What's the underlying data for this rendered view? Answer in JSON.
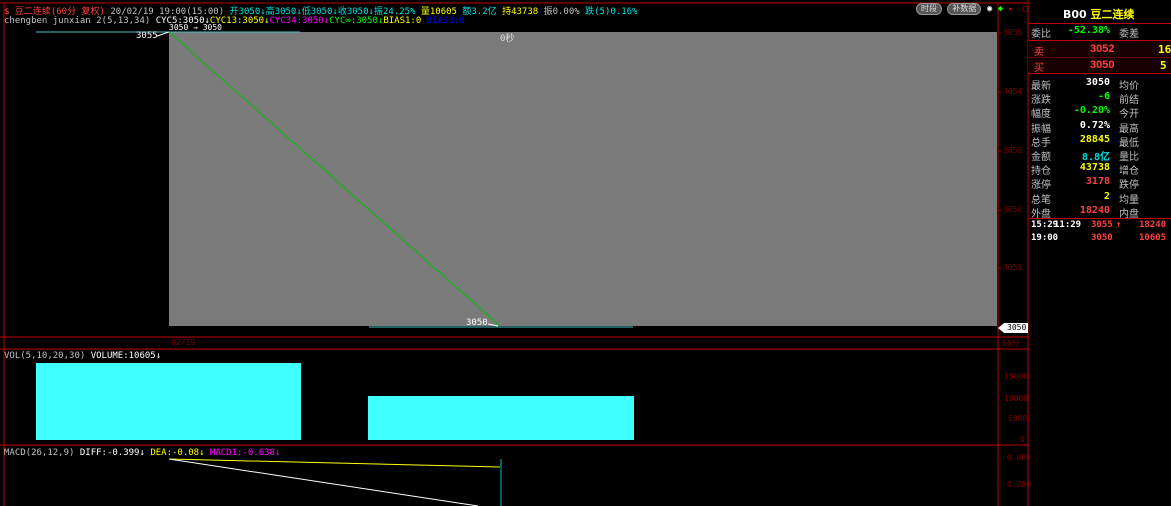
{
  "header": {
    "line1": [
      {
        "text": "$ 豆二连续(60分 复权)",
        "color": "#ff4040"
      },
      {
        "text": " 20/02/19 19:00(15:00) ",
        "color": "#c0c0c0"
      },
      {
        "text": "开3050↓",
        "color": "#00e0e0"
      },
      {
        "text": "高3050↓",
        "color": "#00e0e0"
      },
      {
        "text": "低3050↓",
        "color": "#00e0e0"
      },
      {
        "text": "收3050↓",
        "color": "#00e0e0"
      },
      {
        "text": "振24.25%",
        "color": "#00e0e0"
      },
      {
        "text": " 量10605 ",
        "color": "#ffff00"
      },
      {
        "text": "额3.2亿",
        "color": "#00e0e0"
      },
      {
        "text": " 持43738",
        "color": "#ffff00"
      },
      {
        "text": " 振0.00% ",
        "color": "#c0c0c0"
      },
      {
        "text": "跌(5)0.16%",
        "color": "#00e0e0"
      }
    ],
    "line2": [
      {
        "text": "chengben junxian 2(5,13,34) ",
        "color": "#c0c0c0"
      },
      {
        "text": "CYC5:3050↓",
        "color": "#ffffff"
      },
      {
        "text": "CYC13:3050↓",
        "color": "#ffff00"
      },
      {
        "text": "CYC34:3050↓",
        "color": "#ff00ff"
      },
      {
        "text": "CYC∞:3050↓",
        "color": "#00ff00"
      },
      {
        "text": "BIAS1:0 ",
        "color": "#ffff00"
      },
      {
        "text": "BIAS3:0",
        "color": "#0000ff"
      }
    ],
    "buttons": [
      "时段",
      "补数据"
    ]
  },
  "main_chart": {
    "high_label": "3055",
    "low_label": "3050",
    "top_overlay_label": "3050 → 3050",
    "countdown": "0秒",
    "price_axis": [
      "3055",
      "3054",
      "3053",
      "3052",
      "3051"
    ],
    "current_price_tag": "3050",
    "date_label": "02/19",
    "period_label": "60分"
  },
  "volume_panel": {
    "title_label": "VOL(5,10,20,30) ",
    "title_value": "VOLUME:10605↓",
    "axis": [
      "15000",
      "10000",
      "5000",
      "0"
    ]
  },
  "macd_panel": {
    "title_label": "MACD(26,12,9) ",
    "diff": "DIFF:-0.399↓",
    "dea": "DEA:-0.08↓",
    "macd": "MACD1:-0.638↓",
    "axis": [
      "-0.080",
      "-0.280"
    ]
  },
  "quote_panel": {
    "code": "B00",
    "name": "豆二连续",
    "weibi_label": "委比",
    "weibi_value": "-52.38%",
    "weicha_label": "委差",
    "sell_label": "卖",
    "sell_price": "3052",
    "sell_qty": "16",
    "buy_label": "买",
    "buy_price": "3050",
    "buy_qty": "5",
    "rows": [
      {
        "l": "最新",
        "v": "3050",
        "vc": "#ffffff",
        "r": "均价"
      },
      {
        "l": "涨跌",
        "v": "-6",
        "vc": "#00ff00",
        "r": "前结"
      },
      {
        "l": "幅度",
        "v": "-0.20%",
        "vc": "#00ff00",
        "r": "今开"
      },
      {
        "l": "振幅",
        "v": "0.72%",
        "vc": "#ffffff",
        "r": "最高"
      },
      {
        "l": "总手",
        "v": "28845",
        "vc": "#ffff00",
        "r": "最低"
      },
      {
        "l": "金额",
        "v": "8.8亿",
        "vc": "#00e0e0",
        "r": "量比"
      },
      {
        "l": "持仓",
        "v": "43738",
        "vc": "#ffff00",
        "r": "增仓"
      },
      {
        "l": "涨停",
        "v": "3178",
        "vc": "#ff4040",
        "r": "跌停"
      },
      {
        "l": "总笔",
        "v": "2",
        "vc": "#ffff00",
        "r": "均量"
      },
      {
        "l": "外盘",
        "v": "18240",
        "vc": "#ff4040",
        "r": "内盘"
      }
    ],
    "ticks": [
      {
        "time": "15:29",
        "time2": "11:29",
        "price": "3055",
        "arrow": "↑",
        "vol": "18240"
      },
      {
        "time": "19:00",
        "time2": "",
        "price": "3050",
        "arrow": "",
        "vol": "10605"
      }
    ]
  },
  "colors": {
    "frame_red": "#c00000",
    "price_line": "#00c000",
    "volume_bar": "#40ffff",
    "chart_bg": "#7a7a7a"
  }
}
